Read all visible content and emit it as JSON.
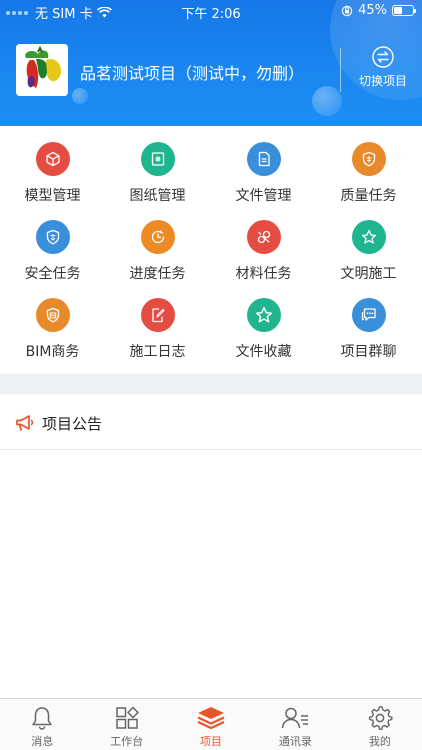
{
  "status_bar": {
    "carrier": "无 SIM 卡",
    "time": "下午 2:06",
    "battery": "45%",
    "battery_level": 0.45
  },
  "header": {
    "project_name": "品茗测试项目（测试中，勿删）",
    "switch_label": "切换项目"
  },
  "modules": [
    {
      "label": "模型管理",
      "icon": "cube-icon",
      "color": "#e54d42"
    },
    {
      "label": "图纸管理",
      "icon": "drawing-icon",
      "color": "#1fb58f"
    },
    {
      "label": "文件管理",
      "icon": "file-icon",
      "color": "#3a8fdb"
    },
    {
      "label": "质量任务",
      "icon": "quality-badge-icon",
      "color": "#e88a2a"
    },
    {
      "label": "安全任务",
      "icon": "safety-shield-icon",
      "color": "#3a8fdb"
    },
    {
      "label": "进度任务",
      "icon": "progress-clock-icon",
      "color": "#ec8a25"
    },
    {
      "label": "材料任务",
      "icon": "material-icon",
      "color": "#e54d42"
    },
    {
      "label": "文明施工",
      "icon": "civilized-star-icon",
      "color": "#1fb58f"
    },
    {
      "label": "BIM商务",
      "icon": "business-icon",
      "color": "#e88a2a"
    },
    {
      "label": "施工日志",
      "icon": "log-edit-icon",
      "color": "#e54d42"
    },
    {
      "label": "文件收藏",
      "icon": "favorite-star-icon",
      "color": "#1fb58f"
    },
    {
      "label": "项目群聊",
      "icon": "chat-icon",
      "color": "#3a8fdb"
    }
  ],
  "announcements": {
    "title": "项目公告",
    "icon": "megaphone-icon",
    "color": "#e8552a"
  },
  "tabbar": {
    "active": "项目",
    "active_color": "#e8552a",
    "items": [
      {
        "label": "消息",
        "icon": "bell-icon"
      },
      {
        "label": "工作台",
        "icon": "workbench-grid-icon"
      },
      {
        "label": "项目",
        "icon": "project-layers-icon"
      },
      {
        "label": "通讯录",
        "icon": "contacts-icon"
      },
      {
        "label": "我的",
        "icon": "settings-gear-icon"
      }
    ]
  }
}
